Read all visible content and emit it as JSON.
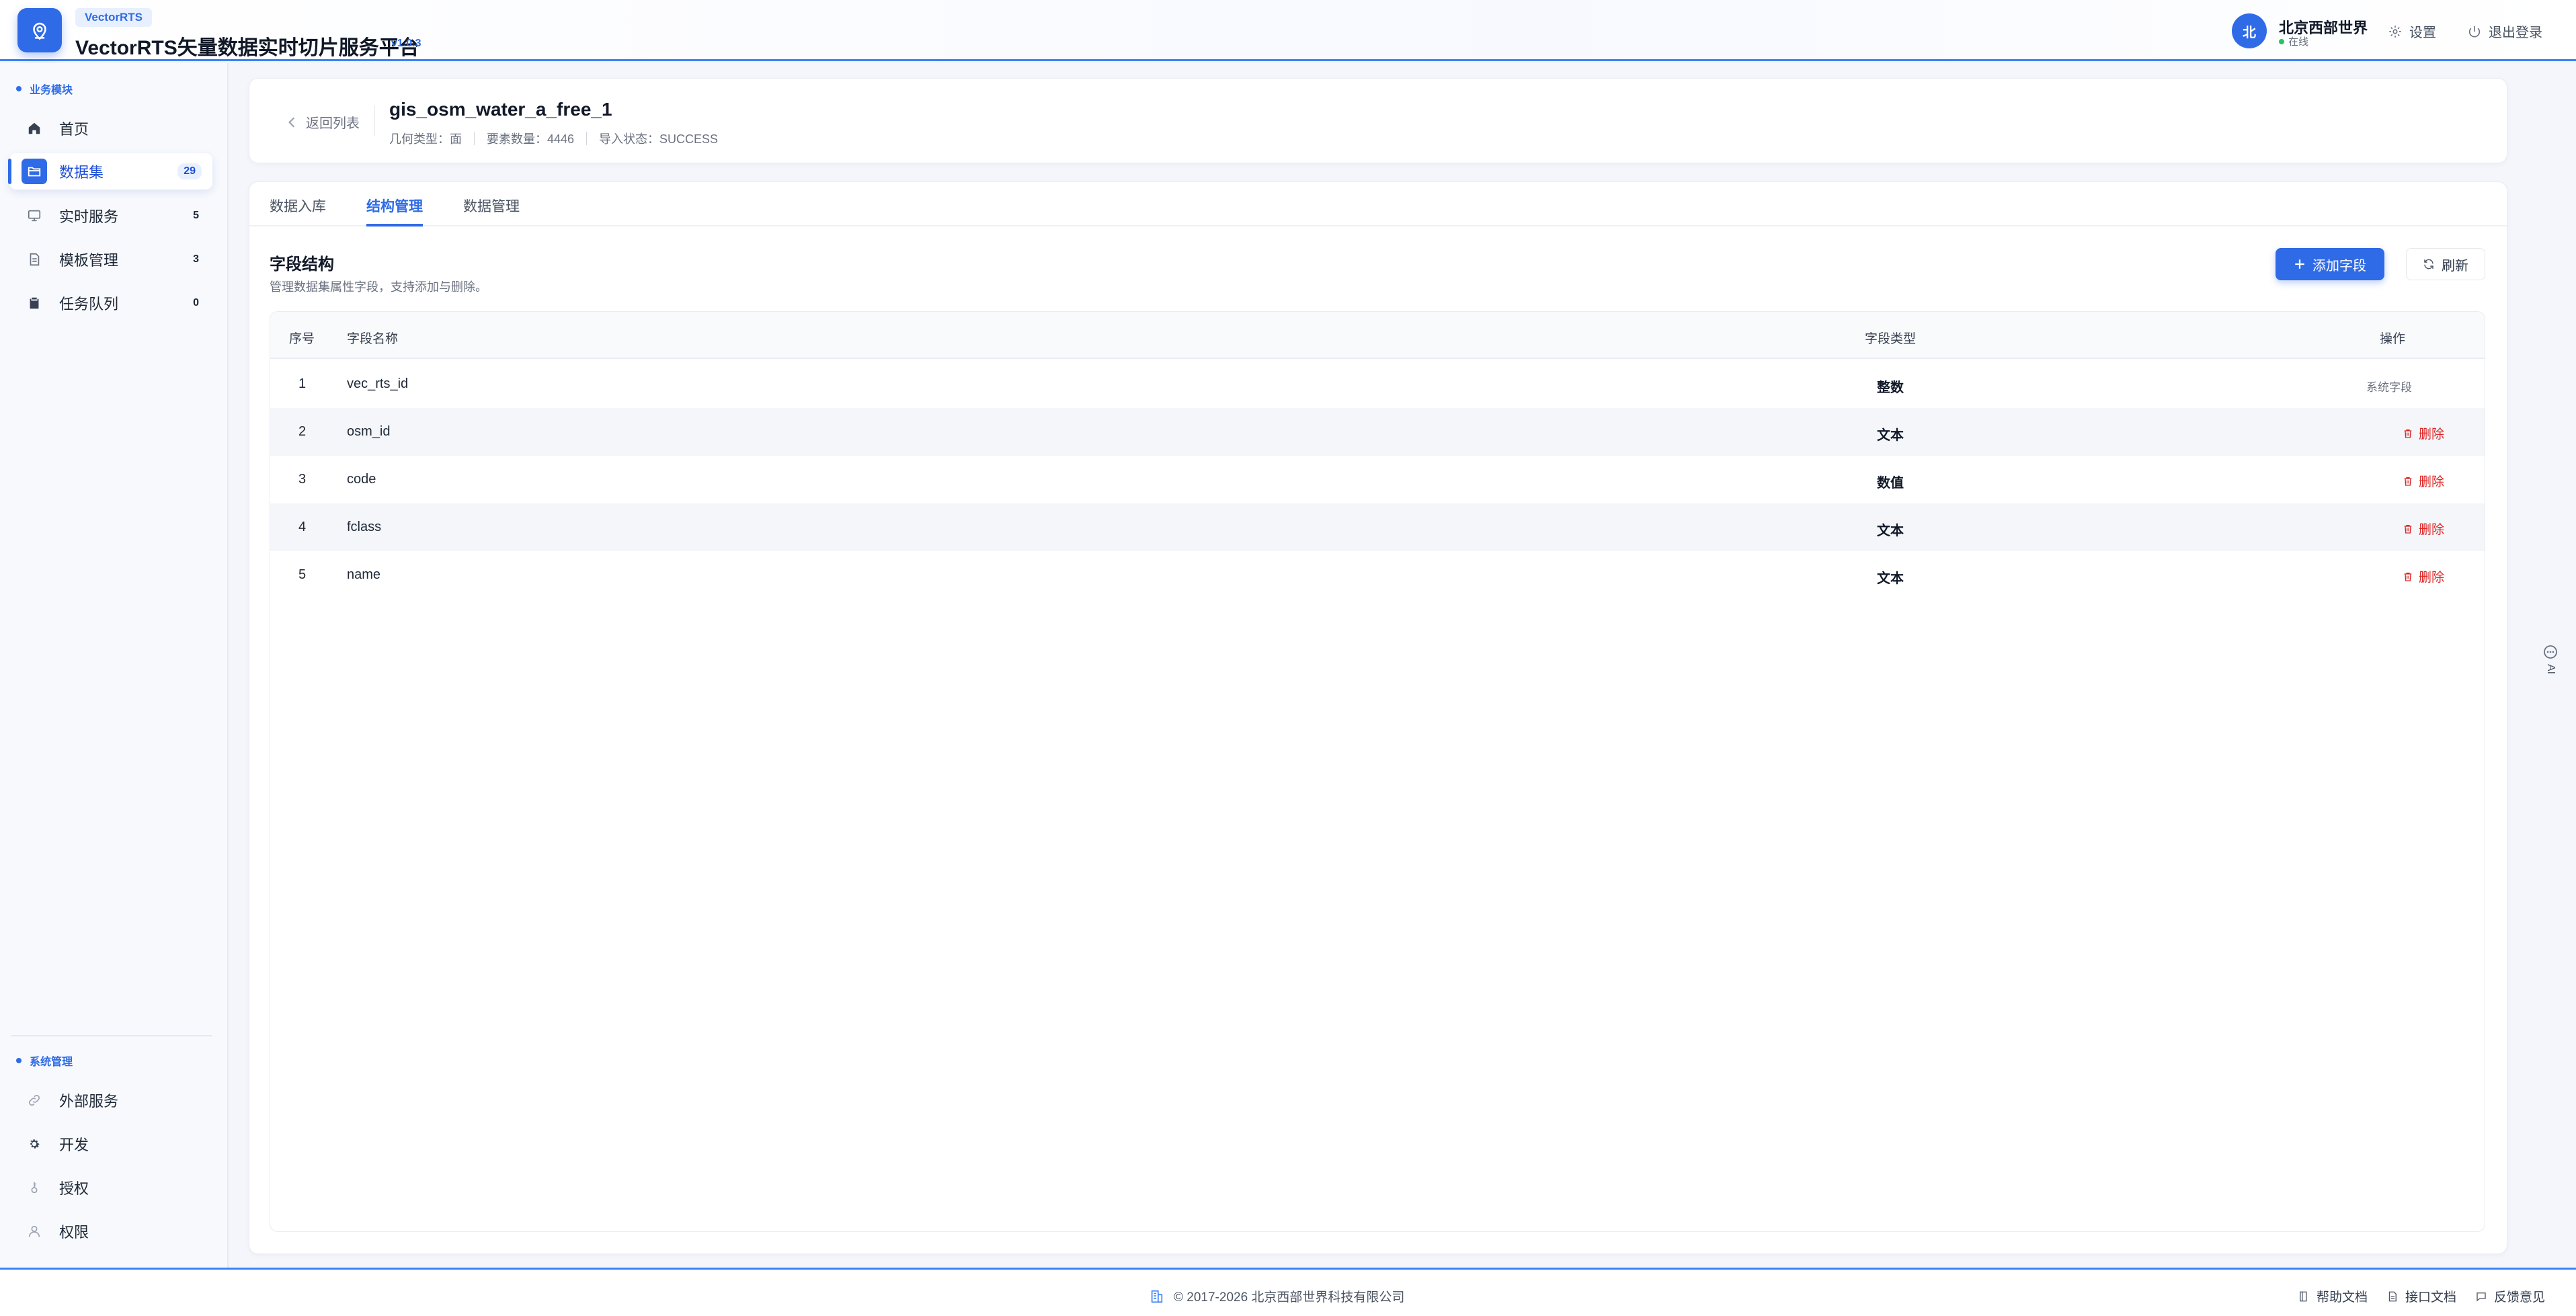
{
  "header": {
    "brand_tag": "VectorRTS",
    "title": "VectorRTS矢量数据实时切片服务平台",
    "version": "v1.0.3",
    "user_avatar": "北",
    "user_name": "北京西部世界",
    "user_status": "在线",
    "settings_label": "设置",
    "logout_label": "退出登录"
  },
  "sidebar": {
    "business_section": "业务模块",
    "items": [
      {
        "label": "首页",
        "badge": "",
        "icon": "home-icon"
      },
      {
        "label": "数据集",
        "badge": "29",
        "icon": "folder-icon"
      },
      {
        "label": "实时服务",
        "badge": "5",
        "icon": "monitor-icon"
      },
      {
        "label": "模板管理",
        "badge": "3",
        "icon": "document-icon"
      },
      {
        "label": "任务队列",
        "badge": "0",
        "icon": "clipboard-icon"
      }
    ],
    "system_section": "系统管理",
    "system_items": [
      {
        "label": "外部服务",
        "icon": "link-icon"
      },
      {
        "label": "开发",
        "icon": "gear-icon"
      },
      {
        "label": "授权",
        "icon": "key-icon"
      },
      {
        "label": "权限",
        "icon": "user-icon"
      }
    ]
  },
  "detail": {
    "back_label": "返回列表",
    "dataset_name": "gis_osm_water_a_free_1",
    "geometry_type": "几何类型：面",
    "feature_count": "要素数量：4446",
    "import_status": "导入状态：SUCCESS"
  },
  "tabs": [
    {
      "label": "数据入库",
      "active": false
    },
    {
      "label": "结构管理",
      "active": true
    },
    {
      "label": "数据管理",
      "active": false
    }
  ],
  "section": {
    "title": "字段结构",
    "description": "管理数据集属性字段，支持添加与删除。",
    "add_button": "添加字段",
    "refresh_button": "刷新"
  },
  "table": {
    "headers": {
      "index": "序号",
      "name": "字段名称",
      "type": "字段类型",
      "action": "操作"
    },
    "rows": [
      {
        "index": "1",
        "name": "vec_rts_id",
        "type": "整数",
        "action": "系统字段"
      },
      {
        "index": "2",
        "name": "osm_id",
        "type": "文本",
        "action": "删除"
      },
      {
        "index": "3",
        "name": "code",
        "type": "数值",
        "action": "删除"
      },
      {
        "index": "4",
        "name": "fclass",
        "type": "文本",
        "action": "删除"
      },
      {
        "index": "5",
        "name": "name",
        "type": "文本",
        "action": "删除"
      }
    ]
  },
  "ai_tab": "AI",
  "footer": {
    "copyright": "© 2017-2026 北京西部世界科技有限公司",
    "help_docs": "帮助文档",
    "api_docs": "接口文档",
    "feedback": "反馈意见"
  },
  "colors": {
    "accent": "#2f6be6",
    "danger": "#dc2626",
    "online": "#22c55e"
  }
}
